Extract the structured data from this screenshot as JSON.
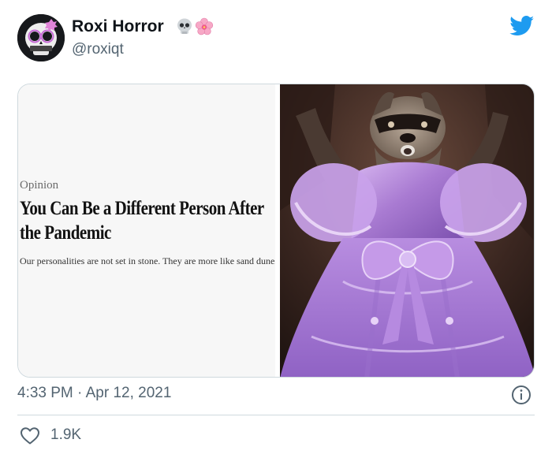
{
  "author": {
    "display_name": "Roxi Horror",
    "handle": "@roxiqt",
    "name_emojis": [
      "skull-emoji",
      "cherry-blossom-emoji"
    ],
    "avatar": "skull-avatar"
  },
  "platform_icon": "twitter-bird-icon",
  "colors": {
    "brand_blue": "#1d9bf0",
    "secondary_text": "#536471",
    "border": "#cfd9de",
    "dress_purple": "#b48ad6"
  },
  "media": {
    "article": {
      "kicker": "Opinion",
      "headline": "You Can Be a Different Person After the Pandemic",
      "summary": "Our personalities are not set in stone. They are more like sand dunes."
    },
    "photo": "raccoon-in-purple-dress-photo"
  },
  "meta": {
    "timestamp": "4:33 PM · Apr 12, 2021",
    "info_icon": "info-icon"
  },
  "actions": {
    "like_icon": "heart-icon",
    "like_count": "1.9K"
  }
}
